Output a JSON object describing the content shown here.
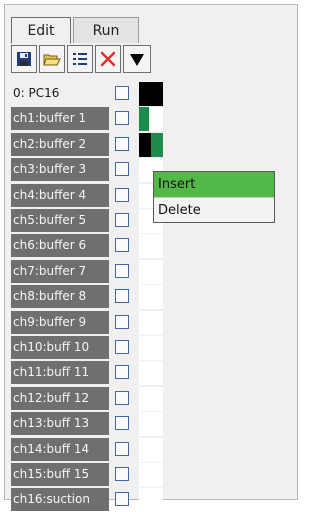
{
  "tabs": {
    "edit": "Edit",
    "run": "Run"
  },
  "toolbar": {
    "icons": [
      "save-icon",
      "open-folder-icon",
      "list-icon",
      "delete-icon",
      "dropdown-arrow-icon"
    ],
    "delete_color": "#e03030"
  },
  "channels": [
    {
      "label": "0: PC16",
      "style": "plain",
      "cell": "black-wide"
    },
    {
      "label": "ch1:buffer 1",
      "style": "shaded",
      "cell": "green"
    },
    {
      "label": "ch2:buffer 2",
      "style": "shaded",
      "cell": "black-green"
    },
    {
      "label": "ch3:buffer 3",
      "style": "shaded",
      "cell": "empty"
    },
    {
      "label": "ch4:buffer 4",
      "style": "shaded",
      "cell": "empty"
    },
    {
      "label": "ch5:buffer 5",
      "style": "shaded",
      "cell": "empty"
    },
    {
      "label": "ch6:buffer 6",
      "style": "shaded",
      "cell": "empty"
    },
    {
      "label": "ch7:buffer 7",
      "style": "shaded",
      "cell": "empty"
    },
    {
      "label": "ch8:buffer 8",
      "style": "shaded",
      "cell": "empty"
    },
    {
      "label": "ch9:buffer 9",
      "style": "shaded",
      "cell": "empty"
    },
    {
      "label": "ch10:buff 10",
      "style": "shaded",
      "cell": "empty"
    },
    {
      "label": "ch11:buff 11",
      "style": "shaded",
      "cell": "empty"
    },
    {
      "label": "ch12:buff 12",
      "style": "shaded",
      "cell": "empty"
    },
    {
      "label": "ch13:buff 13",
      "style": "shaded",
      "cell": "empty"
    },
    {
      "label": "ch14:buff 14",
      "style": "shaded",
      "cell": "empty"
    },
    {
      "label": "ch15:buff 15",
      "style": "shaded",
      "cell": "empty"
    },
    {
      "label": "ch16:suction",
      "style": "shaded",
      "cell": "empty"
    }
  ],
  "context_menu": {
    "insert": "Insert",
    "delete": "Delete",
    "highlight_color": "#52b847"
  },
  "colors": {
    "label_bg": "#6f6f6f",
    "step_on": "#000000",
    "step_green": "#1e8a4c"
  }
}
